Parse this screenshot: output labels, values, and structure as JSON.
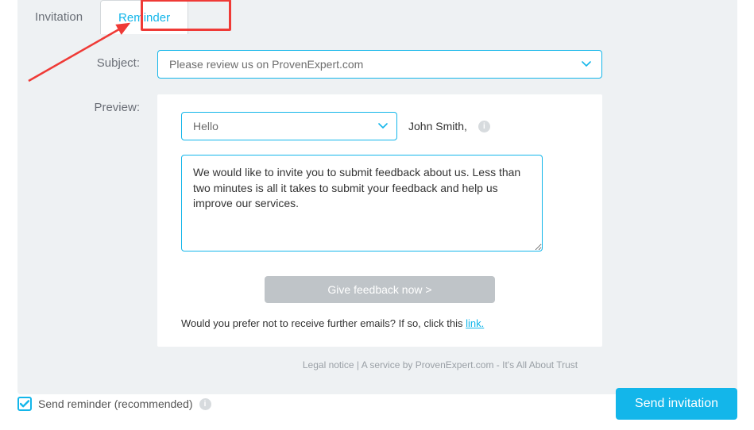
{
  "tabs": {
    "invitation": "Invitation",
    "reminder": "Reminder"
  },
  "labels": {
    "subject": "Subject:",
    "preview": "Preview:"
  },
  "subject": {
    "value": "Please review us on ProvenExpert.com"
  },
  "preview": {
    "greeting": "Hello",
    "recipient": "John Smith,",
    "body": "We would like to invite you to submit feedback about us. Less than two minutes is all it takes to submit your feedback and help us improve our services.",
    "cta": "Give feedback now >",
    "opt_out_text": "Would you prefer not to receive further emails? If so, click this ",
    "opt_out_link": "link."
  },
  "footer": "Legal notice | A service by ProvenExpert.com - It's All About Trust",
  "reminder_checkbox": {
    "checked": true,
    "label": "Send reminder (recommended)"
  },
  "send_button": "Send invitation",
  "colors": {
    "accent": "#13b6ea",
    "callout": "#ef3a36"
  }
}
